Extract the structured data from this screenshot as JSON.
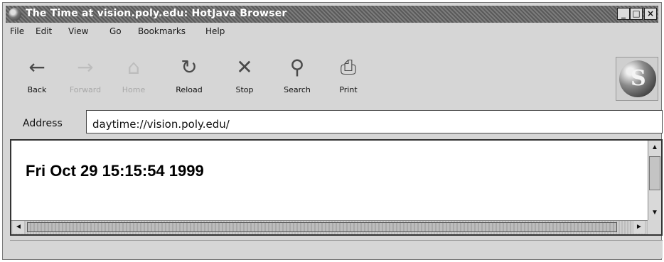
{
  "window": {
    "title": "The Time at vision.poly.edu: HotJava Browser",
    "controls": {
      "minimize": "_",
      "maximize": "□",
      "close": "×"
    }
  },
  "menubar": [
    "File",
    "Edit",
    "View",
    "Go",
    "Bookmarks",
    "Help"
  ],
  "toolbar": [
    {
      "label": "Back",
      "icon": "←",
      "icon_name": "back-arrow-icon",
      "enabled": true
    },
    {
      "label": "Forward",
      "icon": "→",
      "icon_name": "forward-arrow-icon",
      "enabled": false
    },
    {
      "label": "Home",
      "icon": "⌂",
      "icon_name": "home-icon",
      "enabled": false
    },
    {
      "label": "Reload",
      "icon": "↻",
      "icon_name": "reload-icon",
      "enabled": true
    },
    {
      "label": "Stop",
      "icon": "✕",
      "icon_name": "stop-icon",
      "enabled": true
    },
    {
      "label": "Search",
      "icon": "⚲",
      "icon_name": "search-icon",
      "enabled": true
    },
    {
      "label": "Print",
      "icon": "⎙",
      "icon_name": "print-icon",
      "enabled": true
    }
  ],
  "brand": {
    "letter": "S",
    "icon_name": "hotjava-logo-icon"
  },
  "address": {
    "label": "Address",
    "value": "daytime://vision.poly.edu/"
  },
  "page": {
    "text": "Fri Oct 29 15:15:54 1999"
  },
  "scrollbars": {
    "up": "▲",
    "down": "▼",
    "left": "◄",
    "right": "►"
  },
  "colors": {
    "titlebar": "#6a6a6a",
    "chrome": "#d6d6d6",
    "content_bg": "#ffffff"
  }
}
